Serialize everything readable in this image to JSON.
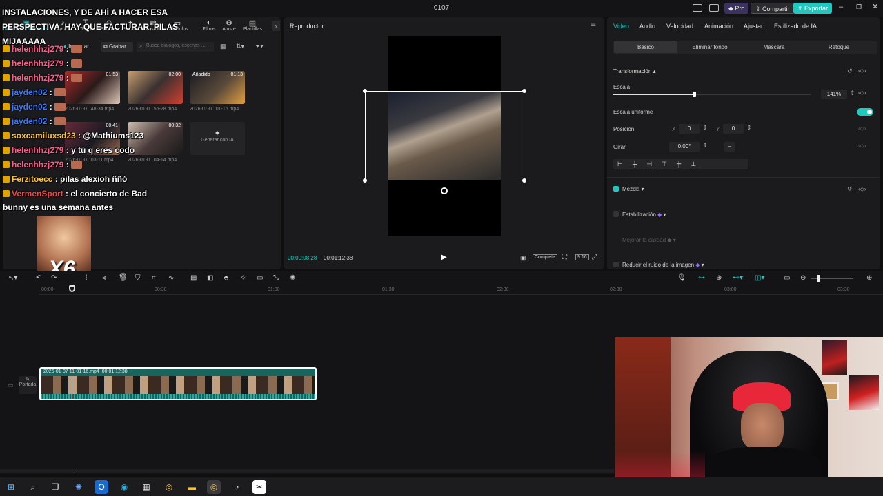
{
  "app": {
    "window_title": "0107",
    "pro_label": "Pro",
    "share_label": "Compartir",
    "export_label": "Exportar",
    "brand_color": "#20c9c0"
  },
  "media_toolbar": {
    "tabs": [
      {
        "label": "Archivos multimedia",
        "icon": "media-icon"
      },
      {
        "label": "Audio",
        "icon": "audio-icon"
      },
      {
        "label": "Texto",
        "icon": "text-icon"
      },
      {
        "label": "Stickers",
        "icon": "sticker-icon"
      },
      {
        "label": "Efectos",
        "icon": "effects-icon"
      },
      {
        "label": "Transiciones",
        "icon": "transition-icon"
      },
      {
        "label": "Subtítulos",
        "icon": "subtitle-icon"
      },
      {
        "label": "Filtros",
        "icon": "filter-icon"
      },
      {
        "label": "Ajuste",
        "icon": "adjust-icon"
      },
      {
        "label": "Plantillas",
        "icon": "template-icon"
      }
    ]
  },
  "media_panel": {
    "import_label": "Importar",
    "record_label": "Grabar",
    "search_placeholder": "Busca diálogos, escenas ...",
    "added_label": "Añadido",
    "clips": [
      {
        "name": "2026-01-0...48-34.mp4",
        "duration": "01:53"
      },
      {
        "name": "2026-01-0...55-28.mp4",
        "duration": "02:00"
      },
      {
        "name": "2026-01-0...01-16.mp4",
        "duration": "01:13"
      },
      {
        "name": "2026-01-0...03-11.mp4",
        "duration": "00:41"
      },
      {
        "name": "2026-01-0...04-14.mp4",
        "duration": "00:32"
      }
    ],
    "ai_generate_label": "Generar con IA"
  },
  "chat_overlay": {
    "header_lines": [
      "INSTALACIONES, Y DE AHÍ A HACER ESA",
      "PERSPECTIVA, HAY QUE FACTURAR, PILAS",
      "MIJAAAAA"
    ],
    "lines": [
      {
        "user": "helenhhzj279",
        "msg": "",
        "cls": "user-pink",
        "badge": "#e0a400"
      },
      {
        "user": "helenhhzj279",
        "msg": "",
        "cls": "user-pink",
        "badge": "#e0a400"
      },
      {
        "user": "helenhhzj279",
        "msg": "",
        "cls": "user-pink",
        "badge": "#e0a400"
      },
      {
        "user": "jayden02",
        "msg": "",
        "cls": "user-blue",
        "badge": "#e0a400"
      },
      {
        "user": "jayden02",
        "msg": "",
        "cls": "user-blue",
        "badge": "#e0a400"
      },
      {
        "user": "jayden02",
        "msg": "",
        "cls": "user-blue",
        "badge": "#e0a400"
      },
      {
        "user": "soxcamiluxsd23",
        "msg": "@Mathiums123",
        "cls": "user-gold",
        "badge": "#e0a400"
      },
      {
        "user": "helenhhzj279",
        "msg": "y tú q eres codo",
        "cls": "user-pink",
        "badge": "#e0a400"
      },
      {
        "user": "helenhhzj279",
        "msg": "",
        "cls": "user-pink",
        "badge": "#e0a400"
      },
      {
        "user": "Ferzitoecc",
        "msg": "pilas alexioh ññó",
        "cls": "user-gold",
        "badge": "#e0a400"
      },
      {
        "user": "VermenSport",
        "msg": "el concierto de Bad",
        "cls": "user-red",
        "badge": "#e0a400"
      }
    ],
    "wrap_line": "bunny es una semana antes",
    "multiplier": "X6"
  },
  "player": {
    "title": "Reproductor",
    "current_time": "00:00:08:28",
    "total_time": "00:01:12:38",
    "full_label": "Completa",
    "ratio_label": "9:16"
  },
  "props": {
    "tabs": [
      "Video",
      "Audio",
      "Velocidad",
      "Animación",
      "Ajustar",
      "Estilizado de IA"
    ],
    "subtabs": [
      "Básico",
      "Eliminar fondo",
      "Máscara",
      "Retoque"
    ],
    "transform_label": "Transformación",
    "scale_label": "Escala",
    "scale_value": "141%",
    "scale_fraction": 0.41,
    "uniform_label": "Escala uniforme",
    "position_label": "Posición",
    "pos_x_label": "X",
    "pos_x": "0",
    "pos_y_label": "Y",
    "pos_y": "0",
    "rotate_label": "Girar",
    "rotate_value": "0.00°",
    "blend_label": "Mezcla",
    "stabilize_label": "Estabilización",
    "quality_label": "Mejorar la calidad",
    "noise_label": "Reducir el ruido de la imagen"
  },
  "timeline": {
    "ruler": [
      "00:00",
      "00:30",
      "01:00",
      "01:30",
      "02:00",
      "02:30",
      "03:00",
      "03:30"
    ],
    "cover_label": "Portada",
    "clip_name": "2026-01-07 11-01-16.mp4",
    "clip_duration": "00:01:12:38"
  },
  "taskbar": {
    "icons": [
      "windows-icon",
      "search-icon",
      "task-view-icon",
      "copilot-icon",
      "outlook-icon",
      "edge-icon",
      "store-icon",
      "chrome-icon",
      "files-icon",
      "chrome-active-icon",
      "obs-icon",
      "capcut-icon"
    ]
  }
}
